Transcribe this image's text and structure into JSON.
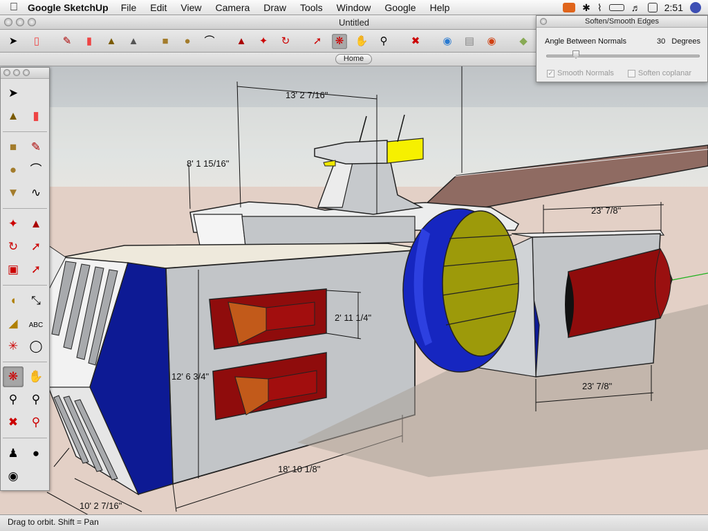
{
  "menubar": {
    "app_name": "Google SketchUp",
    "menus": [
      "File",
      "Edit",
      "View",
      "Camera",
      "Draw",
      "Tools",
      "Window",
      "Google",
      "Help"
    ],
    "clock": "2:51",
    "status_icons": [
      "sketchup-status-icon",
      "bluetooth-icon",
      "wifi-icon",
      "battery-icon",
      "volume-icon",
      "input-method-icon",
      "spotlight-icon"
    ]
  },
  "window": {
    "title": "Untitled"
  },
  "toolbar": {
    "home_label": "Home",
    "buttons": [
      "select",
      "eraser",
      "pencil",
      "eraser-pink",
      "paint-bucket",
      "paint-bucket-2",
      "rectangle",
      "circle",
      "arc",
      "push-pull",
      "move",
      "rotate",
      "follow-me",
      "orbit",
      "pan",
      "zoom",
      "zoom-extents",
      "google-earth",
      "get-models",
      "share-model",
      "components"
    ],
    "active": "orbit"
  },
  "palette": {
    "tools": [
      "select",
      "make-component",
      "paint-bucket",
      "eraser",
      "rectangle",
      "line",
      "circle",
      "arc",
      "polygon",
      "freehand",
      "move",
      "push-pull",
      "rotate",
      "follow-me",
      "scale",
      "offset",
      "tape-measure",
      "dimension",
      "protractor",
      "text",
      "axes",
      "3d-text",
      "orbit",
      "pan",
      "zoom",
      "zoom-window",
      "zoom-extents",
      "previous",
      "position-camera",
      "walk",
      "look-around"
    ],
    "active": "orbit"
  },
  "soften_panel": {
    "title": "Soften/Smooth Edges",
    "angle_label": "Angle Between Normals",
    "angle_value": "30",
    "angle_unit": "Degrees",
    "angle_fraction": 0.17,
    "smooth_normals_label": "Smooth Normals",
    "smooth_normals_checked": true,
    "soften_coplanar_label": "Soften coplanar",
    "soften_coplanar_checked": false,
    "enabled": false
  },
  "dimensions": {
    "top_width": "13' 2 7/16\"",
    "turret_height": "8' 1 15/16\"",
    "right_top": "23' 7/8\"",
    "vent_height": "2' 11 1/4\"",
    "body_height": "12' 6 3/4\"",
    "right_bottom": "23' 7/8\"",
    "body_length": "18' 10 1/8\"",
    "front_width": "10' 2 7/16\""
  },
  "status": {
    "hint": "Drag to orbit.  Shift = Pan"
  },
  "colors": {
    "sky_top": "#c7cbcd",
    "ground": "#e3d0c6",
    "hull_gray": "#c2c5c8",
    "front_blue": "#0d1a94",
    "vent_red": "#8f0c0c",
    "lens_olive": "#9d9a0a",
    "ring_blue": "#1626c0",
    "turret_yellow": "#f6f000",
    "wing_brown": "#8f6b62"
  }
}
